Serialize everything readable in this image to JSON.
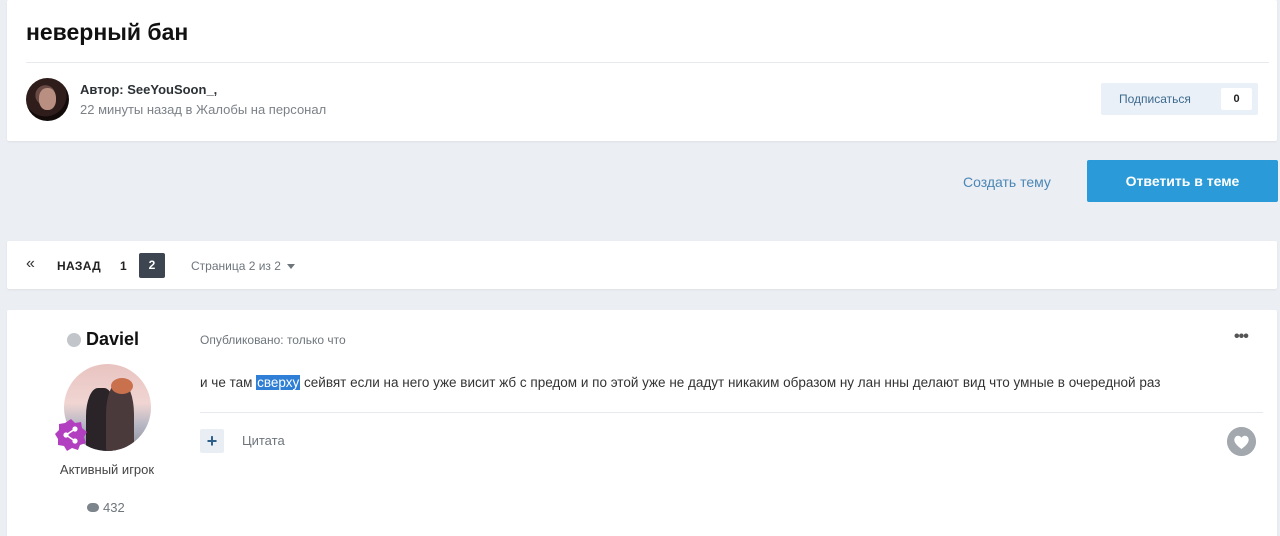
{
  "topic": {
    "title": "неверный бан",
    "author_line": "Автор: SeeYouSoon_,",
    "meta_line": "22 минуты назад в Жалобы на персонал",
    "follow_label": "Подписаться",
    "follow_count": "0"
  },
  "actions": {
    "create_topic": "Создать тему",
    "reply": "Ответить в теме"
  },
  "pagination": {
    "prev_icon": "«",
    "prev_label": "НАЗАД",
    "pages": [
      "1",
      "2"
    ],
    "current_page": "2",
    "page_info": "Страница 2 из 2"
  },
  "post": {
    "author": "Daviel",
    "rank": "Активный игрок",
    "post_count": "432",
    "date": "Опубликовано: только что",
    "menu_icon": "•••",
    "body_before": "и че там ",
    "body_highlight": "сверху",
    "body_after": " сейвят если на него уже висит жб с предом и по этой уже не дадут никаким образом ну лан нны делают вид что умные в очередной раз",
    "multiquote_icon": "+",
    "quote_label": "Цитата"
  },
  "colors": {
    "accent": "#2a9bd8",
    "link": "#4b87b6",
    "highlight": "#2f7fd6",
    "rank_badge": "#b23fbf"
  },
  "icons": {
    "comment": "comment-bubble-icon",
    "like": "heart-icon",
    "badge": "share-nodes-icon"
  }
}
